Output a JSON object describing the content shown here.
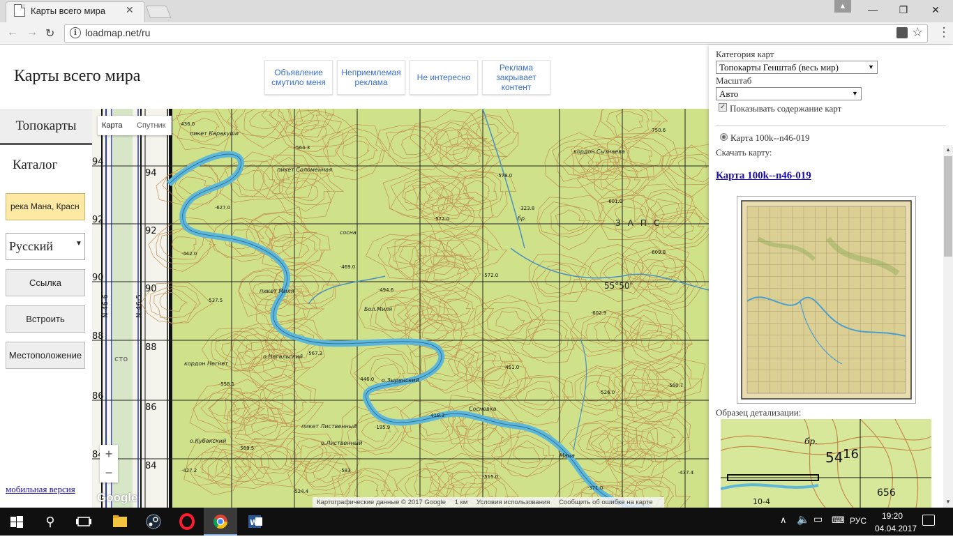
{
  "browser": {
    "tab_title": "Карты всего мира",
    "url": "loadmap.net/ru",
    "win_controls": [
      "—",
      "❐",
      "✕"
    ]
  },
  "header": {
    "site_title": "Карты всего мира",
    "ad_feedback": [
      "Объявление смутило меня",
      "Неприемлемая реклама",
      "Не интересно",
      "Реклама закрывает контент"
    ]
  },
  "sidebar": {
    "tab_topo": "Топокарты",
    "tab_catalog": "Каталог",
    "search_value": "река Мана, Красн",
    "language": "Русский",
    "buttons": [
      "Ссылка",
      "Встроить",
      "Местоположение"
    ],
    "mobile_link": "мобильная версия"
  },
  "map": {
    "type_map": "Карта",
    "type_satellite": "Спутник",
    "zoom_in": "+",
    "zoom_out": "−",
    "google_logo": "Google",
    "attribution": {
      "data": "Картографические данные © 2017 Google",
      "scale": "1 км",
      "terms": "Условия использования",
      "report": "Сообщить об ошибке на карте"
    },
    "grid_labels_left": [
      "94",
      "92",
      "90",
      "88",
      "86",
      "84"
    ],
    "grid_labels_edge": [
      "84",
      "86",
      "88",
      "90",
      "92",
      "94"
    ],
    "sheet_codes": [
      "N-46-6",
      "N-46-5"
    ],
    "left_partial_label": "сто",
    "place_labels": [
      "пикет Каракуши",
      "пикет Соломенная",
      "пикет Миля",
      "о.Нагальский",
      "кордон Негнет",
      "о.Кубакский",
      "о.Лиственный",
      "пикет Лиственный",
      "о.Зырянский",
      "Сосновка",
      "Мана",
      "Бол.Миля",
      "кордон Сызнаева",
      "сосна",
      "бр.",
      "ЗАПС",
      "55°50'"
    ],
    "elevations": [
      "564.3",
      "627.0",
      "578.0",
      "601.0",
      "323.8",
      "572.0",
      "469.0",
      "572.0",
      "609.8",
      "537.5",
      "494.6",
      "602.9",
      "567.3",
      "446.0",
      "451.0",
      "558.1",
      "526.0",
      "560.7",
      "418.3",
      "195.9",
      "569.5",
      "427.2",
      "583",
      "515.0",
      "371.0",
      "437.4",
      "524.4",
      "442.0",
      "750.6",
      "436.0"
    ]
  },
  "right_panel": {
    "category_label": "Категория карт",
    "category_value": "Топокарты Генштаб (весь мир)",
    "scale_label": "Масштаб",
    "scale_value": "Авто",
    "show_contents_label": "Показывать содержание карт",
    "show_contents_checked": true,
    "map_radio_label": "Карта 100k--n46-019",
    "download_label": "Скачать карту:",
    "download_link": "Карта 100k--n46-019",
    "detail_label": "Образец детализации:",
    "detail_numbers": [
      "54",
      "16",
      "656",
      "10-4",
      "бр."
    ]
  },
  "taskbar": {
    "lang": "РУС",
    "time": "19:20",
    "date": "04.04.2017"
  },
  "colors": {
    "map_green": "#cfe28a",
    "contour_brown": "#c28a4a",
    "river_blue": "#5fb7d8",
    "link_blue": "#1a0dab",
    "search_yellow": "#fee9a4"
  }
}
